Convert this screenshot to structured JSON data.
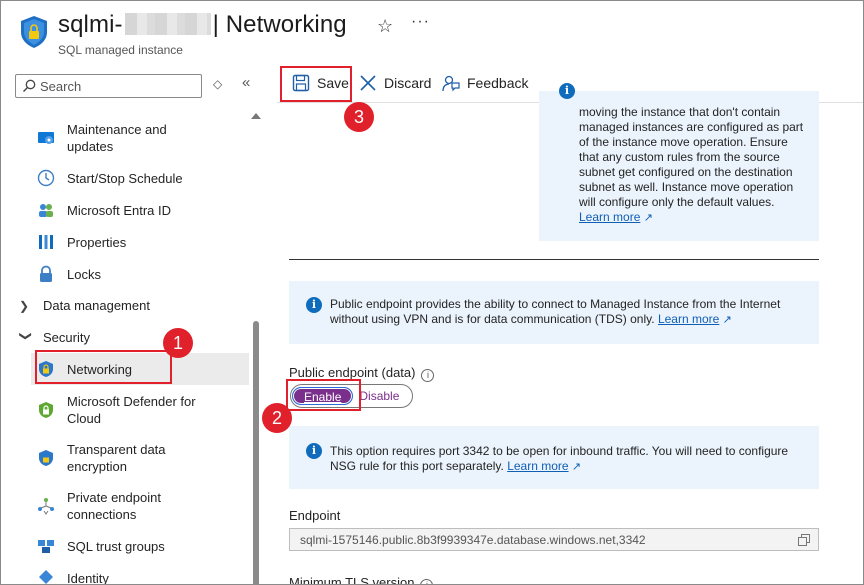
{
  "header": {
    "title_prefix": "sqlmi-",
    "title_suffix": "| Networking",
    "subtitle": "SQL managed instance",
    "favorite_icon": "star-icon",
    "more_icon": "ellipsis-icon"
  },
  "sidebar": {
    "search_placeholder": "Search",
    "items": [
      {
        "label": "Maintenance and updates",
        "icon": "maintenance-icon"
      },
      {
        "label": "Start/Stop Schedule",
        "icon": "clock-icon"
      },
      {
        "label": "Microsoft Entra ID",
        "icon": "users-icon"
      },
      {
        "label": "Properties",
        "icon": "properties-icon"
      },
      {
        "label": "Locks",
        "icon": "lock-icon"
      },
      {
        "label": "Networking",
        "icon": "shield-icon"
      },
      {
        "label": "Microsoft Defender for Cloud",
        "icon": "defender-icon"
      },
      {
        "label": "Transparent data encryption",
        "icon": "encryption-icon"
      },
      {
        "label": "Private endpoint connections",
        "icon": "private-endpoint-icon"
      },
      {
        "label": "SQL trust groups",
        "icon": "trust-group-icon"
      },
      {
        "label": "Identity",
        "icon": "identity-icon"
      }
    ],
    "groups": [
      {
        "label": "Data management",
        "expanded": false
      },
      {
        "label": "Security",
        "expanded": true
      }
    ],
    "active_item": "Networking"
  },
  "toolbar": {
    "save_label": "Save",
    "discard_label": "Discard",
    "feedback_label": "Feedback"
  },
  "content": {
    "move_info": {
      "lines": [
        "moving the instance that don't contain",
        "managed instances are configured as part",
        "of the instance move operation. Ensure",
        "that any custom rules from the source",
        "subnet get configured on the destination",
        "subnet as well. Instance move operation",
        "will configure only the default values."
      ],
      "link": "Learn more"
    },
    "public_info": {
      "line1": "Public endpoint provides the ability to connect to Managed Instance from the Internet",
      "line2": "without using VPN and is for data communication (TDS) only.",
      "link": "Learn more"
    },
    "public_endpoint_label": "Public endpoint (data)",
    "toggle": {
      "enable": "Enable",
      "disable": "Disable",
      "selected": "Enable"
    },
    "port_info": {
      "line1": "This option requires port 3342 to be open for inbound traffic. You will need to configure",
      "line2": "NSG rule for this port separately.",
      "link": "Learn more"
    },
    "endpoint_label": "Endpoint",
    "endpoint_value": "sqlmi-1575146.public.8b3f9939347e.database.windows.net,3342",
    "min_tls_label": "Minimum TLS version"
  },
  "annotations": {
    "badge1": "1",
    "badge2": "2",
    "badge3": "3"
  },
  "colors": {
    "accent": "#0f6cbd",
    "annotation_red": "#e0202a",
    "toggle_selected": "#7a2f8d",
    "info_bg": "#ebf3fc"
  }
}
